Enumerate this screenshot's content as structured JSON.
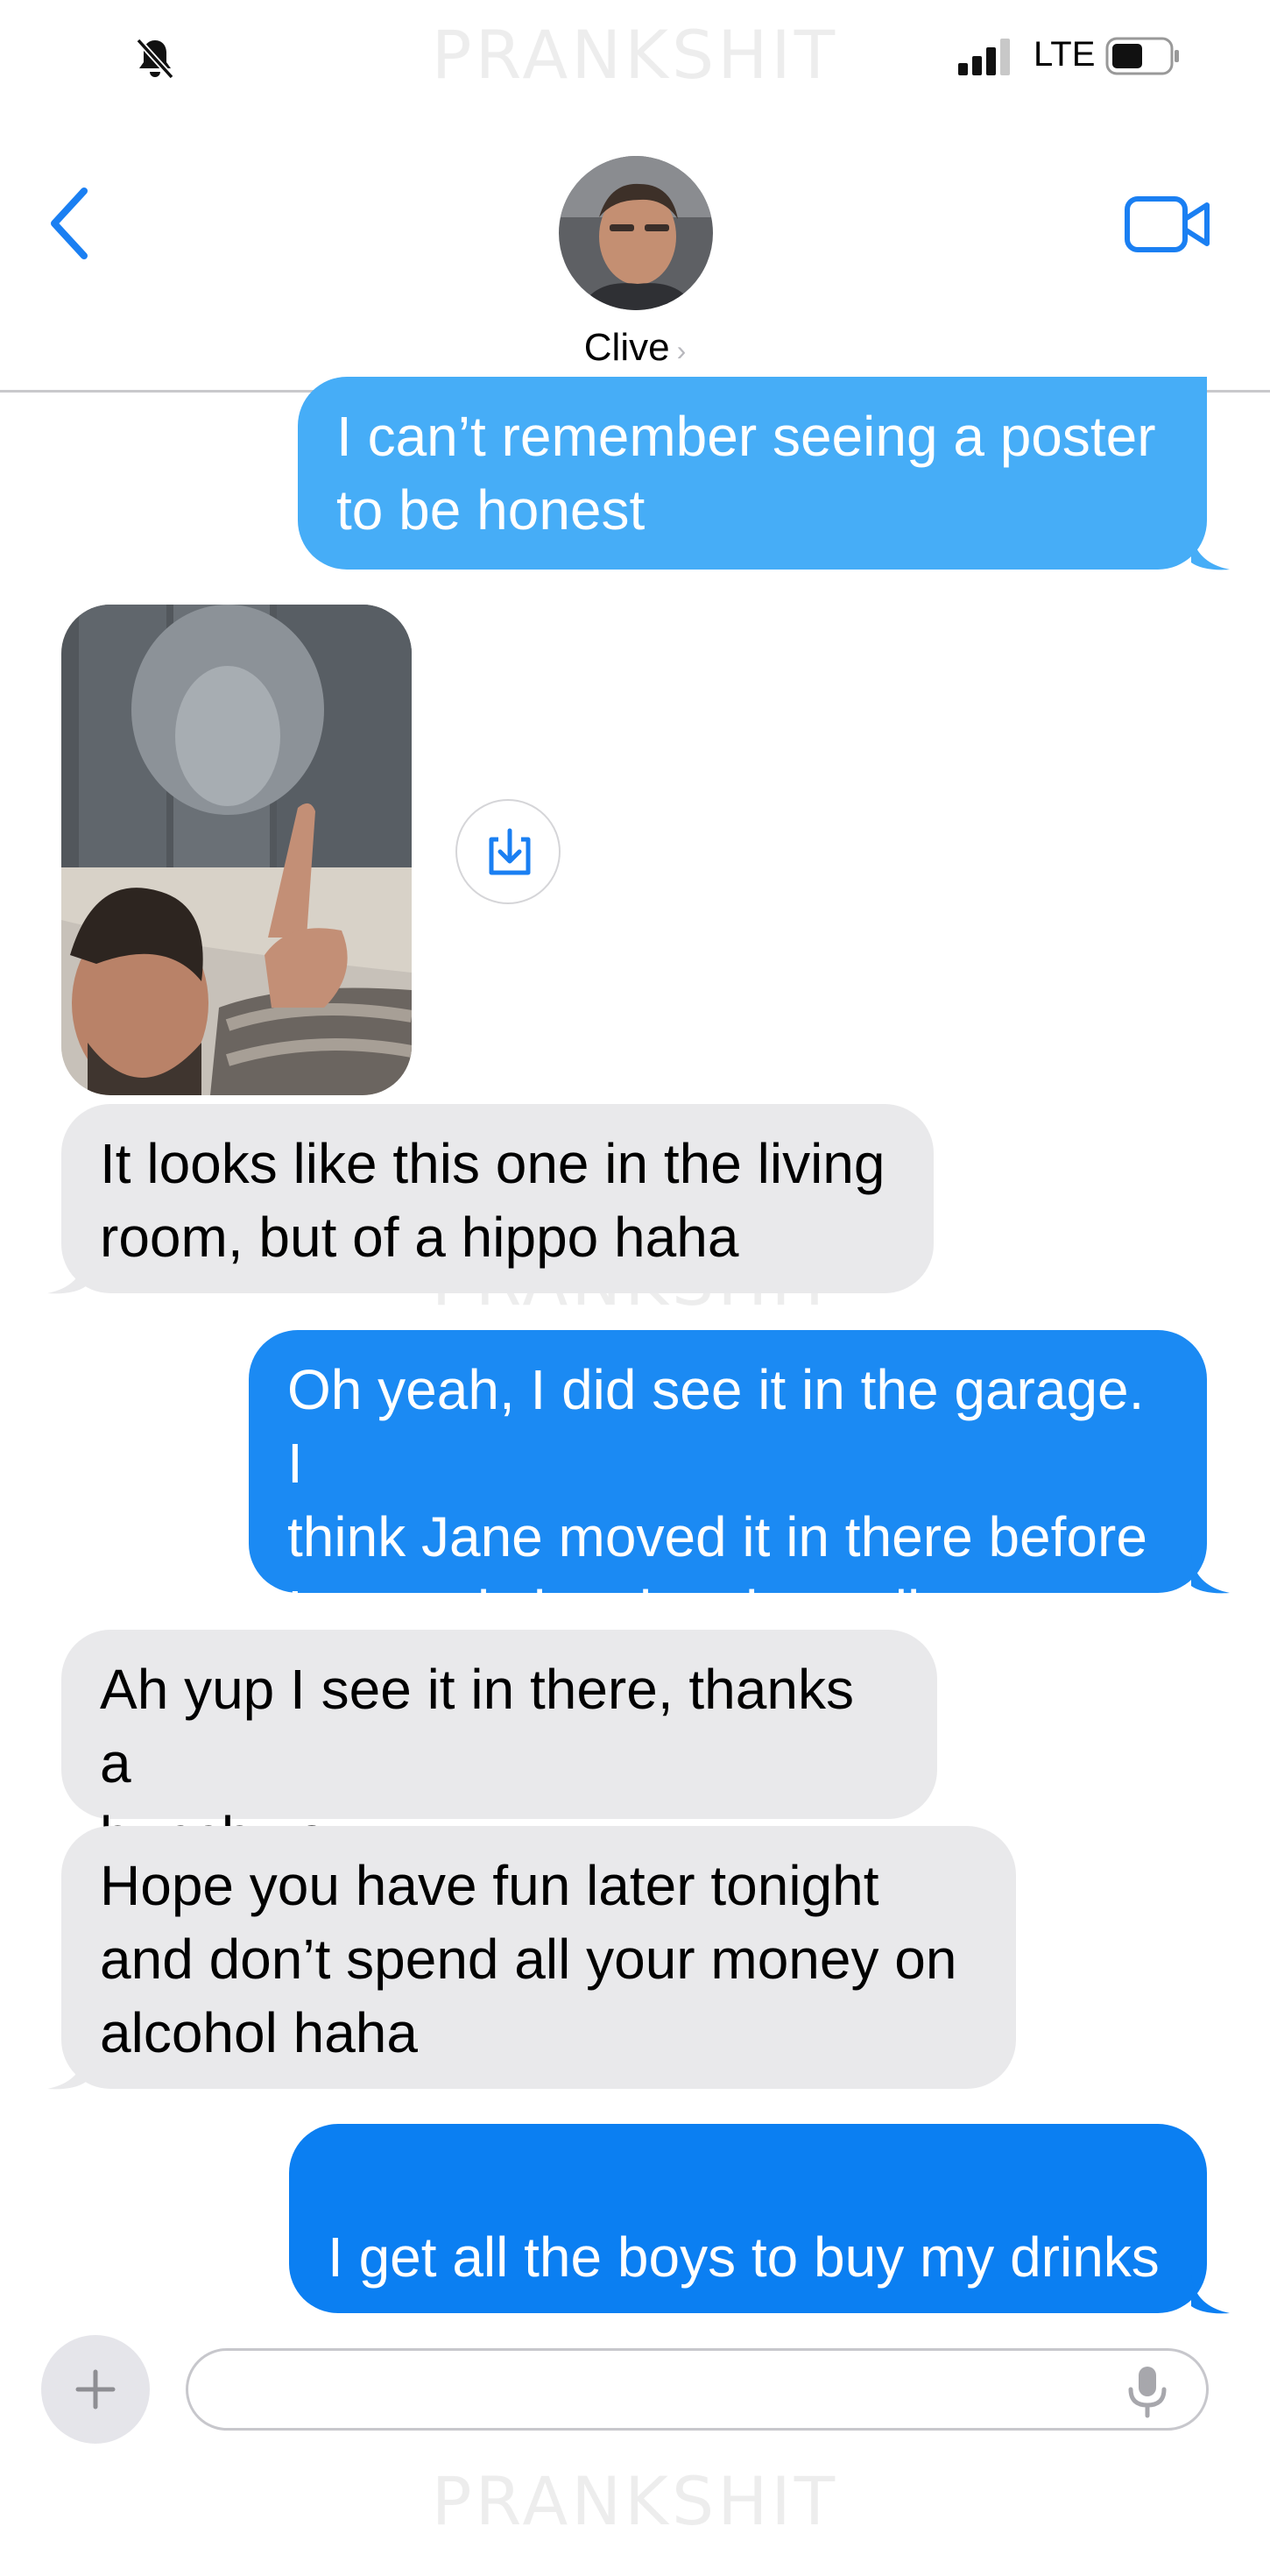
{
  "status_bar": {
    "network": "LTE",
    "watermark": "PRANKSHIT"
  },
  "header": {
    "contact_name": "Clive",
    "name_chevron": "›"
  },
  "messages": [
    {
      "direction": "outgoing",
      "text": "I can’t remember seeing a poster\nto be honest",
      "color": "#46adf7"
    },
    {
      "direction": "incoming",
      "type": "photo",
      "description_icon": "photo-attachment"
    },
    {
      "direction": "incoming",
      "text": "It looks like this one in the living\nroom, but of a hippo haha"
    },
    {
      "direction": "outgoing",
      "text": "Oh yeah, I did see it in the garage. I\nthink Jane moved it in there before\nI started cleaning the walls",
      "color": "#1b8af3"
    },
    {
      "direction": "incoming",
      "text": "Ah yup I see it in there, thanks a\nbunch xo"
    },
    {
      "direction": "incoming",
      "text": "Hope you have fun later tonight\nand don’t spend all your money on\nalcohol haha"
    },
    {
      "direction": "outgoing",
      "text": "I get all the boys to buy my drinks",
      "emoji": "😉",
      "color": "#0b7ff2"
    }
  ],
  "compose": {
    "placeholder": ""
  },
  "colors": {
    "accent": "#1a7ff2",
    "incoming_bubble": "#e9e9eb"
  }
}
